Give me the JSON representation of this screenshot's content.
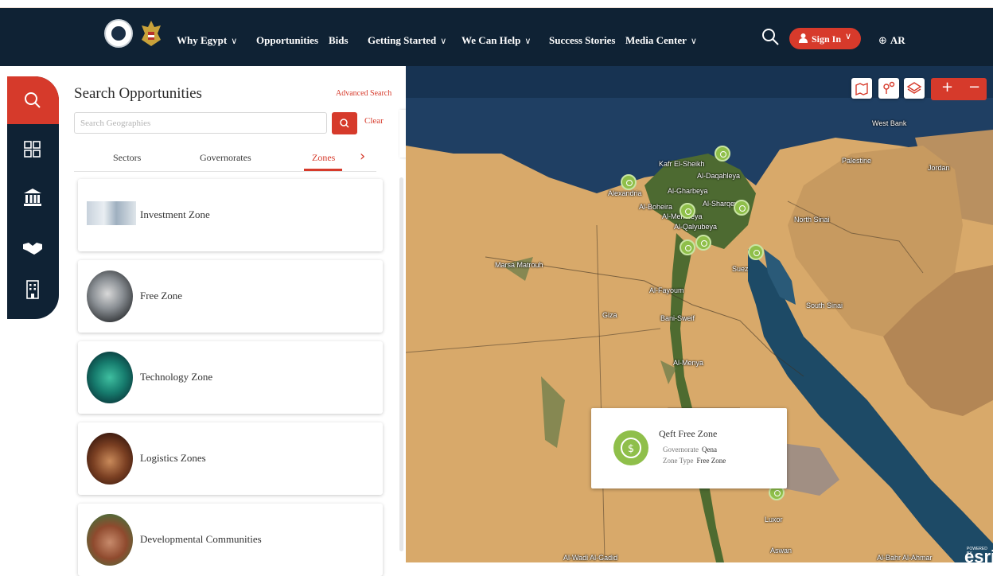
{
  "nav": {
    "items": [
      {
        "label": "Why Egypt",
        "dropdown": true
      },
      {
        "label": "Opportunities",
        "dropdown": false
      },
      {
        "label": "Bids",
        "dropdown": false
      },
      {
        "label": "Getting Started",
        "dropdown": true
      },
      {
        "label": "We Can Help",
        "dropdown": true
      },
      {
        "label": "Success Stories",
        "dropdown": false
      },
      {
        "label": "Media Center",
        "dropdown": true
      }
    ],
    "signin_label": "Sign In",
    "lang_label": "AR"
  },
  "panel": {
    "title": "Search Opportunities",
    "advanced_search": "Advanced Search",
    "search_placeholder": "Search Geographies",
    "clear_label": "Clear",
    "tabs": [
      "Sectors",
      "Governorates",
      "Zones"
    ],
    "active_tab": "Zones",
    "cards": [
      {
        "label": "Investment Zone"
      },
      {
        "label": "Free Zone"
      },
      {
        "label": "Technology Zone"
      },
      {
        "label": "Logistics Zones"
      },
      {
        "label": "Developmental Communities"
      }
    ]
  },
  "map": {
    "places": [
      "West Bank",
      "Palestine",
      "Jordan",
      "Kafr El-Sheikh",
      "Al-Daqahleya",
      "Alexandria",
      "Al-Gharbeya",
      "Al-Boheira",
      "Al-Sharqeya",
      "Al-Menofeya",
      "Al-Qalyubeya",
      "North Sinai",
      "Marsa Matrouh",
      "Suez",
      "Al-Fayoum",
      "South Sinai",
      "Giza",
      "Bani-Sweif",
      "Al-Menya",
      "Luxor",
      "Aswan",
      "Al-Wadi Al-Gadid",
      "Al-Bahr Al-Ahmar"
    ],
    "esri_label": "esri",
    "attribution": "POWERED BY"
  },
  "popup": {
    "title": "Qeft Free Zone",
    "governorate_label": "Governorate",
    "governorate_value": "Qena",
    "zone_type_label": "Zone Type",
    "zone_type_value": "Free Zone"
  },
  "colors": {
    "navy": "#0f2234",
    "accent_red": "#d63a2b",
    "pin_green": "#8fbf4a"
  }
}
